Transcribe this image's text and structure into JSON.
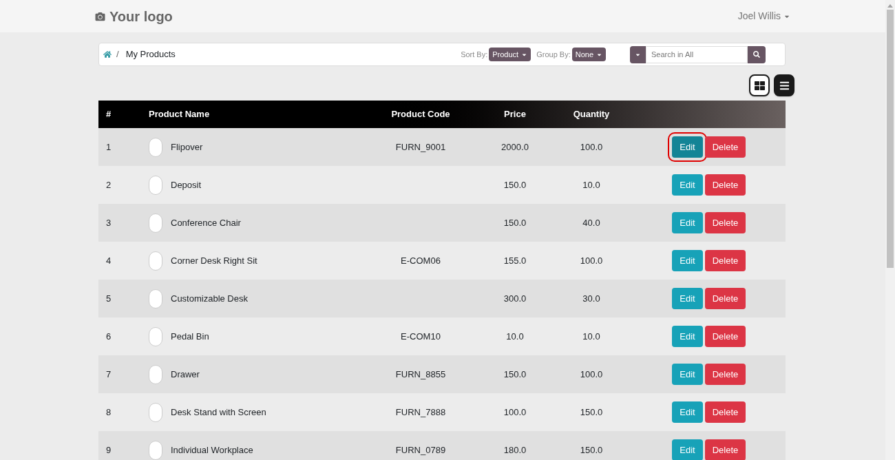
{
  "header": {
    "logo": "Your logo",
    "user": "Joel Willis"
  },
  "breadcrumb": {
    "separator": "/",
    "current": "My Products"
  },
  "toolbar": {
    "sort_label": "Sort By:",
    "sort_value": "Product",
    "group_label": "Group By:",
    "group_value": "None",
    "search_placeholder": "Search in All"
  },
  "view_toggle": [
    {
      "kind": "grid",
      "selected": false
    },
    {
      "kind": "list",
      "selected": true
    }
  ],
  "table": {
    "columns": [
      "#",
      "Product Name",
      "Product Code",
      "Price",
      "Quantity"
    ],
    "rows": [
      {
        "index": "1",
        "name": "Flipover",
        "code": "FURN_9001",
        "price": "2000.0",
        "quantity": "100.0",
        "edit": "Edit",
        "delete": "Delete",
        "edit_highlighted": true
      },
      {
        "index": "2",
        "name": "Deposit",
        "price": "150.0",
        "quantity": "10.0",
        "edit": "Edit",
        "delete": "Delete",
        "edit_highlighted": false
      },
      {
        "index": "3",
        "name": "Conference Chair",
        "price": "150.0",
        "quantity": "40.0",
        "edit": "Edit",
        "delete": "Delete",
        "edit_highlighted": false
      },
      {
        "index": "4",
        "name": "Corner Desk Right Sit",
        "code": "E-COM06",
        "price": "155.0",
        "quantity": "100.0",
        "edit": "Edit",
        "delete": "Delete",
        "edit_highlighted": false
      },
      {
        "index": "5",
        "name": "Customizable Desk",
        "price": "300.0",
        "quantity": "30.0",
        "edit": "Edit",
        "delete": "Delete",
        "edit_highlighted": false
      },
      {
        "index": "6",
        "name": "Pedal Bin",
        "code": "E-COM10",
        "price": "10.0",
        "quantity": "10.0",
        "edit": "Edit",
        "delete": "Delete",
        "edit_highlighted": false
      },
      {
        "index": "7",
        "name": "Drawer",
        "code": "FURN_8855",
        "price": "150.0",
        "quantity": "100.0",
        "edit": "Edit",
        "delete": "Delete",
        "edit_highlighted": false
      },
      {
        "index": "8",
        "name": "Desk Stand with Screen",
        "code": "FURN_7888",
        "price": "100.0",
        "quantity": "150.0",
        "edit": "Edit",
        "delete": "Delete",
        "edit_highlighted": false
      },
      {
        "index": "9",
        "name": "Individual Workplace",
        "code": "FURN_0789",
        "price": "180.0",
        "quantity": "150.0",
        "edit": "Edit",
        "delete": "Delete",
        "edit_highlighted": false
      }
    ]
  }
}
